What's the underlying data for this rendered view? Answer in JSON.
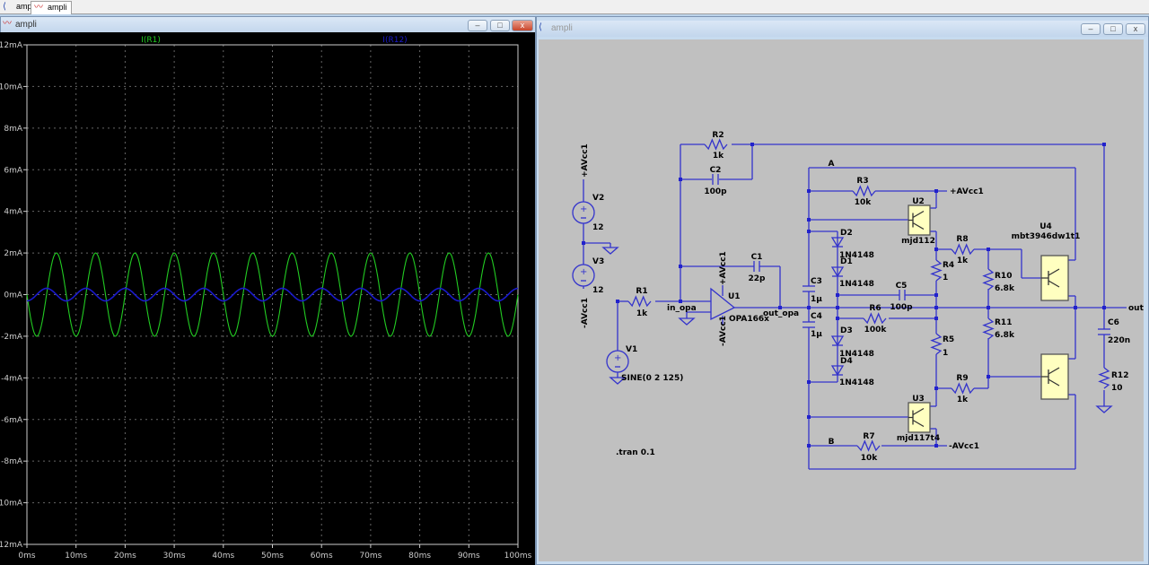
{
  "tabs": [
    {
      "label": "ampli",
      "icon": "schematic-icon"
    },
    {
      "label": "ampli",
      "icon": "waveform-icon",
      "active": true
    }
  ],
  "plot_window": {
    "title": "ampli",
    "icon": "waveform-icon",
    "buttons": [
      "minimize",
      "maximize",
      "close"
    ]
  },
  "schematic_window": {
    "title": "ampli",
    "icon": "schematic-icon",
    "buttons": [
      "minimize",
      "maximize",
      "close"
    ]
  },
  "chart_data": {
    "type": "line",
    "xlabel": "",
    "ylabel": "",
    "xlim": [
      0,
      100
    ],
    "ylim": [
      -12,
      12
    ],
    "x_unit": "ms",
    "y_unit": "mA",
    "x_ticks": [
      "0ms",
      "10ms",
      "20ms",
      "30ms",
      "40ms",
      "50ms",
      "60ms",
      "70ms",
      "80ms",
      "90ms",
      "100ms"
    ],
    "y_ticks": [
      "12mA",
      "10mA",
      "8mA",
      "6mA",
      "4mA",
      "2mA",
      "0mA",
      "-2mA",
      "-4mA",
      "-6mA",
      "-8mA",
      "-10mA",
      "-12mA"
    ],
    "grid": true,
    "background": "#000000",
    "series": [
      {
        "name": "I(R1)",
        "color": "#22cc22",
        "waveform": "sine",
        "amplitude_mA": 2,
        "frequency_Hz": 125,
        "phase_deg": 180,
        "offset_mA": 0
      },
      {
        "name": "I(R12)",
        "color": "#1a1acc",
        "waveform": "sine",
        "amplitude_mA": 0.3,
        "frequency_Hz": 125,
        "phase_deg": -90,
        "offset_mA": 0
      }
    ]
  },
  "schematic": {
    "wire_color": "#3333cc",
    "part_fill": "#ffffc0",
    "background": "#c0c0c0",
    "directive": ".tran 0.1",
    "nets": {
      "in_opa": "in_opa",
      "out_opa": "out_opa",
      "out": "out",
      "A": "A",
      "B": "B",
      "vcc_r3": "+AVcc1",
      "vee_r7": "-AVcc1",
      "v2_top": "+AVcc1",
      "v3_bot": "-AVcc1",
      "u1_pos": "+AVcc1",
      "u1_neg": "-AVcc1"
    },
    "parts": {
      "R1": [
        "R1",
        "1k"
      ],
      "R2": [
        "R2",
        "1k"
      ],
      "C2": [
        "C2",
        "100p"
      ],
      "C1": [
        "C1",
        "22p"
      ],
      "V1": [
        "V1",
        "SINE(0 2 125)"
      ],
      "V2": [
        "V2",
        "12"
      ],
      "V3": [
        "V3",
        "12"
      ],
      "U1": [
        "U1",
        "OPA166x"
      ],
      "C3": [
        "C3",
        "1µ"
      ],
      "C4": [
        "C4",
        "1µ"
      ],
      "D1": [
        "D1",
        "1N4148"
      ],
      "D2": [
        "D2",
        "1N4148"
      ],
      "D3": [
        "D3",
        "1N4148"
      ],
      "D4": [
        "D4",
        "1N4148"
      ],
      "R3": [
        "R3",
        "10k"
      ],
      "R7": [
        "R7",
        "10k"
      ],
      "U2": [
        "U2",
        "mjd112"
      ],
      "U3": [
        "U3",
        "mjd117t4"
      ],
      "R4": [
        "R4",
        "1"
      ],
      "R5": [
        "R5",
        "1"
      ],
      "R6": [
        "R6",
        "100k"
      ],
      "C5": [
        "C5",
        "100p"
      ],
      "R8": [
        "R8",
        "1k"
      ],
      "R9": [
        "R9",
        "1k"
      ],
      "R10": [
        "R10",
        "6.8k"
      ],
      "R11": [
        "R11",
        "6.8k"
      ],
      "U4": [
        "U4",
        "mbt3946dw1t1"
      ],
      "C6": [
        "C6",
        "220n"
      ],
      "R12": [
        "R12",
        "10"
      ]
    }
  }
}
